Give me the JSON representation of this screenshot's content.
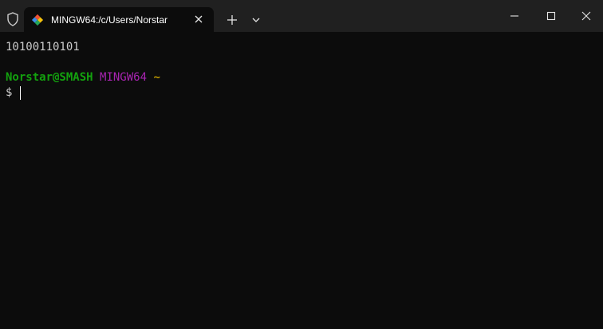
{
  "tab": {
    "title": "MINGW64:/c/Users/Norstar"
  },
  "icons": {
    "shield": "shield-icon",
    "tab_app": "git-bash-icon",
    "tab_close": "close-icon",
    "new_tab": "plus-icon",
    "dropdown": "chevron-down-icon",
    "minimize": "minimize-icon",
    "maximize": "maximize-icon",
    "close_window": "close-icon"
  },
  "terminal": {
    "output": "10100110101",
    "prompt": {
      "user_host": "Norstar@SMASH",
      "env": "MINGW64",
      "path": "~"
    },
    "prompt_symbol": "$"
  },
  "colors": {
    "background": "#0c0c0c",
    "titlebar": "#202020",
    "user_host": "#13a10e",
    "env": "#a824b1",
    "path": "#c19c00",
    "text": "#cccccc"
  }
}
